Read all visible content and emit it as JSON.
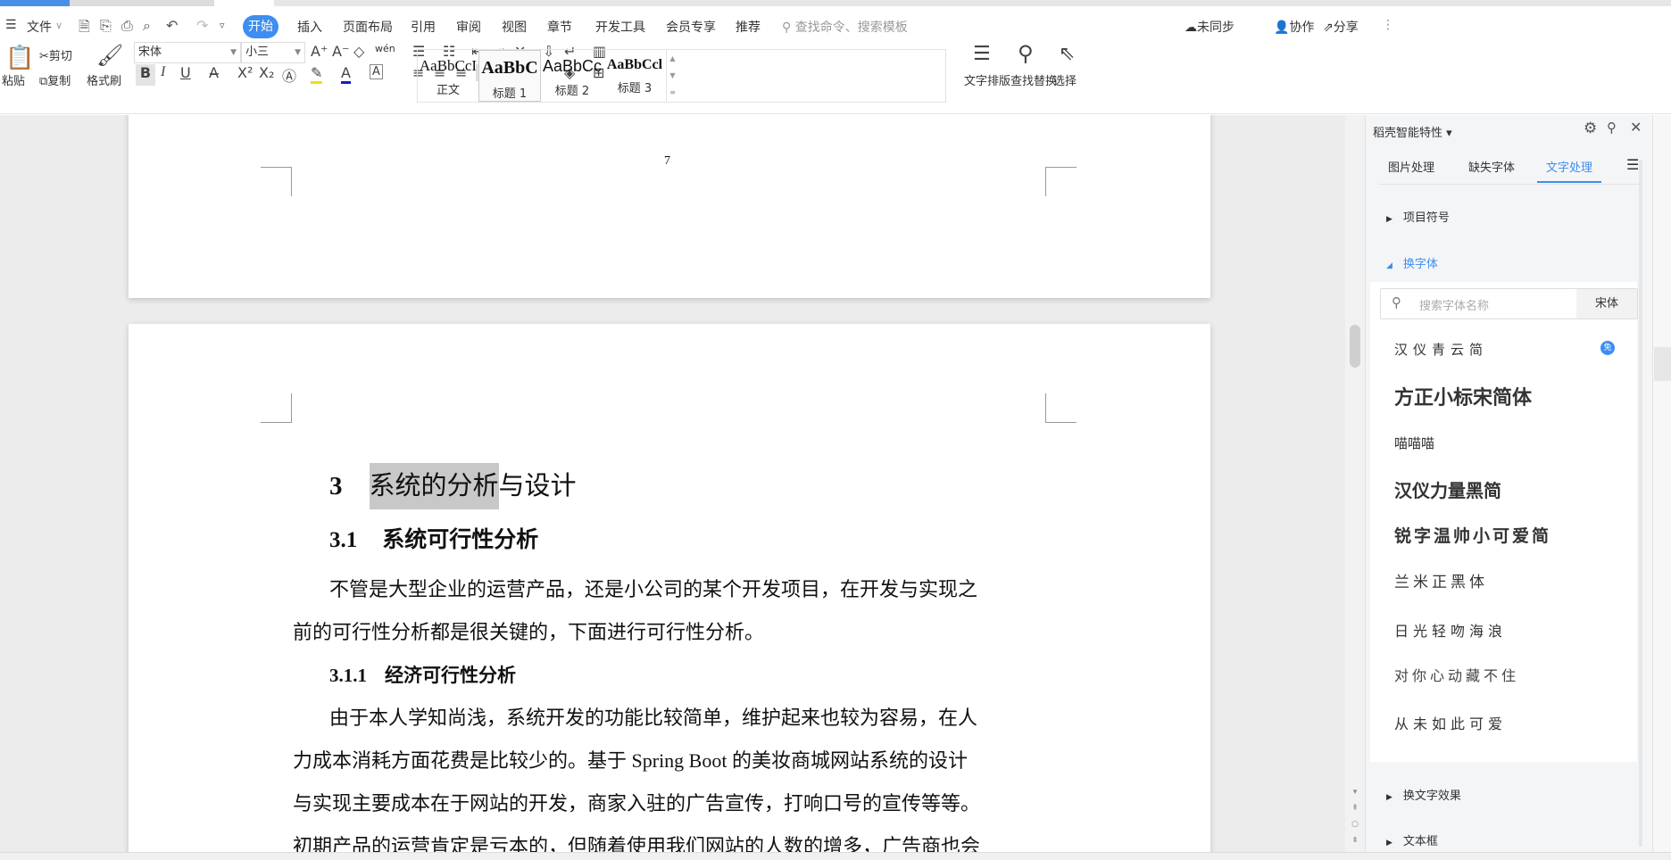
{
  "menu": {
    "file": "文件",
    "tabs": [
      "开始",
      "插入",
      "页面布局",
      "引用",
      "审阅",
      "视图",
      "章节",
      "开发工具",
      "会员专享",
      "推荐"
    ],
    "search_placeholder": "查找命令、搜索模板",
    "sync": "未同步",
    "collab": "协作",
    "share": "分享"
  },
  "ribbon": {
    "paste": "粘贴",
    "cut": "剪切",
    "copy": "复制",
    "format_painter": "格式刷",
    "font": "宋体",
    "size": "小三",
    "bold": "B",
    "italic": "I",
    "underline": "U",
    "pinyin": "wén",
    "styles": [
      {
        "sample": "AaBbCcI",
        "label": "正文"
      },
      {
        "sample": "AaBbC",
        "label": "标题 1"
      },
      {
        "sample": "AaBbCc",
        "label": "标题 2"
      },
      {
        "sample": "AaBbCcl",
        "label": "标题 3"
      }
    ],
    "text_layout": "文字排版",
    "find_replace": "查找替换",
    "select": "选择"
  },
  "document": {
    "page_number": "7",
    "heading1": {
      "num": "3",
      "selected": "系统的分析",
      "rest": "与设计"
    },
    "heading2": {
      "num": "3.1",
      "text": "系统可行性分析"
    },
    "para1": [
      "不管是大型企业的运营产品，还是小公司的某个开发项目，在开发与实现之",
      "前的可行性分析都是很关键的，下面进行可行性分析。"
    ],
    "heading3": {
      "num": "3.1.1",
      "text": "经济可行性分析"
    },
    "para2": [
      "由于本人学知尚浅，系统开发的功能比较简单，维护起来也较为容易，在人",
      "力成本消耗方面花费是比较少的。基于 Spring Boot 的美妆商城网站系统的设计",
      "与实现主要成本在于网站的开发，商家入驻的广告宣传，打响口号的宣传等等。",
      "初期产品的运营肯定是亏本的，但随着使用我们网站的人数的增多，广告商也会"
    ]
  },
  "panel": {
    "title": "稻壳智能特性",
    "tabs": [
      "图片处理",
      "缺失字体",
      "文字处理"
    ],
    "sections": {
      "bullets": "项目符号",
      "change_font": "换字体",
      "text_effects": "换文字效果",
      "textbox": "文本框"
    },
    "search_placeholder": "搜索字体名称",
    "current_font": "宋体",
    "free_badge": "免",
    "fonts": [
      "汉仪青云简",
      "方正小标宋简体",
      "喵喵喵",
      "汉仪力量黑简",
      "锐字温帅小可爱简",
      "兰米正黑体",
      "日光轻吻海浪",
      "对你心动藏不住",
      "从未如此可爱"
    ]
  },
  "colors": {
    "accent": "#3d8ef0",
    "selection": "#c8c8c8"
  }
}
